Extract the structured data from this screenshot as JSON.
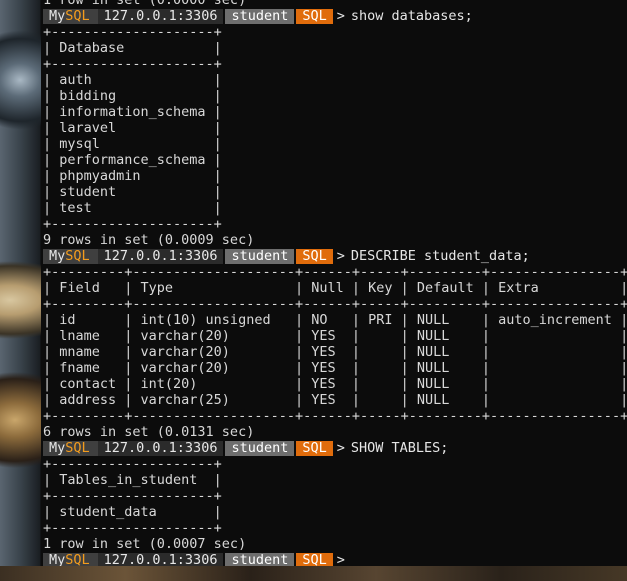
{
  "terminal": {
    "lines": [
      {
        "kind": "text",
        "text": "1 row in set (0.0000 sec)"
      },
      {
        "kind": "prompt",
        "cmd": "show databases;"
      },
      {
        "kind": "text",
        "text": "+--------------------+"
      },
      {
        "kind": "text",
        "text": "| Database           |"
      },
      {
        "kind": "text",
        "text": "+--------------------+"
      },
      {
        "kind": "text",
        "text": "| auth               |"
      },
      {
        "kind": "text",
        "text": "| bidding            |"
      },
      {
        "kind": "text",
        "text": "| information_schema |"
      },
      {
        "kind": "text",
        "text": "| laravel            |"
      },
      {
        "kind": "text",
        "text": "| mysql              |"
      },
      {
        "kind": "text",
        "text": "| performance_schema |"
      },
      {
        "kind": "text",
        "text": "| phpmyadmin         |"
      },
      {
        "kind": "text",
        "text": "| student            |"
      },
      {
        "kind": "text",
        "text": "| test               |"
      },
      {
        "kind": "text",
        "text": "+--------------------+"
      },
      {
        "kind": "text",
        "text": "9 rows in set (0.0009 sec)"
      },
      {
        "kind": "prompt",
        "cmd": "DESCRIBE student_data;"
      },
      {
        "kind": "text",
        "text": "+---------+--------------------+------+-----+---------+----------------+"
      },
      {
        "kind": "text",
        "text": "| Field   | Type               | Null | Key | Default | Extra          |"
      },
      {
        "kind": "text",
        "text": "+---------+--------------------+------+-----+---------+----------------+"
      },
      {
        "kind": "text",
        "text": "| id      | int(10) unsigned   | NO   | PRI | NULL    | auto_increment |"
      },
      {
        "kind": "text",
        "text": "| lname   | varchar(20)        | YES  |     | NULL    |                |"
      },
      {
        "kind": "text",
        "text": "| mname   | varchar(20)        | YES  |     | NULL    |                |"
      },
      {
        "kind": "text",
        "text": "| fname   | varchar(20)        | YES  |     | NULL    |                |"
      },
      {
        "kind": "text",
        "text": "| contact | int(20)            | YES  |     | NULL    |                |"
      },
      {
        "kind": "text",
        "text": "| address | varchar(25)        | YES  |     | NULL    |                |"
      },
      {
        "kind": "text",
        "text": "+---------+--------------------+------+-----+---------+----------------+"
      },
      {
        "kind": "text",
        "text": "6 rows in set (0.0131 sec)"
      },
      {
        "kind": "prompt",
        "cmd": "SHOW TABLES;"
      },
      {
        "kind": "text",
        "text": "+--------------------+"
      },
      {
        "kind": "text",
        "text": "| Tables_in_student  |"
      },
      {
        "kind": "text",
        "text": "+--------------------+"
      },
      {
        "kind": "text",
        "text": "| student_data       |"
      },
      {
        "kind": "text",
        "text": "+--------------------+"
      },
      {
        "kind": "text",
        "text": "1 row in set (0.0007 sec)"
      },
      {
        "kind": "prompt",
        "cmd": ""
      }
    ],
    "prompt": {
      "my": "My",
      "sql": "SQL",
      "host": "127.0.0.1:3306",
      "db": "student",
      "mode": "SQL",
      "arrow": ">"
    }
  },
  "colors": {
    "background": "#0c0c0c",
    "text": "#d8d8d8",
    "sql_orange": "#e06c0c",
    "mysql_label_orange": "#f39c1e"
  }
}
